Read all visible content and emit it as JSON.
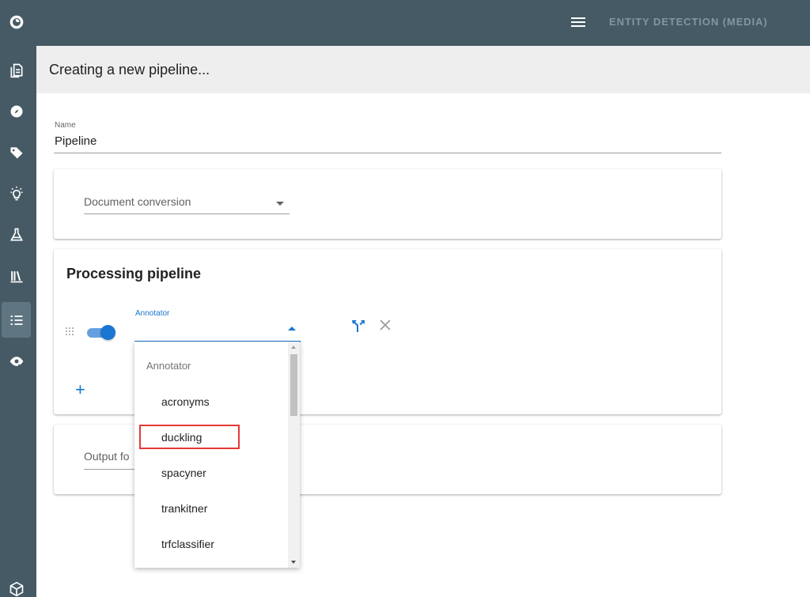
{
  "topbar": {
    "app_title": "ENTITY DETECTION (MEDIA)",
    "menu_icon": "menu-icon"
  },
  "sidebar": {
    "items": [
      {
        "icon": "eye-logo-icon"
      },
      {
        "icon": "document-icon"
      },
      {
        "icon": "compass-icon"
      },
      {
        "icon": "tag-icon"
      },
      {
        "icon": "lightbulb-icon"
      },
      {
        "icon": "flask-icon"
      },
      {
        "icon": "library-icon"
      },
      {
        "icon": "list-icon",
        "active": true
      },
      {
        "icon": "eye-check-icon"
      },
      {
        "icon": "cube-icon"
      }
    ]
  },
  "page": {
    "title": "Creating a new pipeline..."
  },
  "name_field": {
    "label": "Name",
    "value": "Pipeline"
  },
  "doc_conversion": {
    "placeholder": "Document conversion"
  },
  "processing": {
    "title": "Processing pipeline",
    "annotator_label": "Annotator",
    "enabled": true
  },
  "output": {
    "placeholder_visible": "Output fo"
  },
  "dropdown": {
    "header": "Annotator",
    "options": [
      "acronyms",
      "duckling",
      "spacyner",
      "trankitner",
      "trfclassifier"
    ],
    "highlighted": "duckling"
  },
  "colors": {
    "rail": "#455a64",
    "accent": "#1976d2",
    "highlight": "#e53935"
  }
}
